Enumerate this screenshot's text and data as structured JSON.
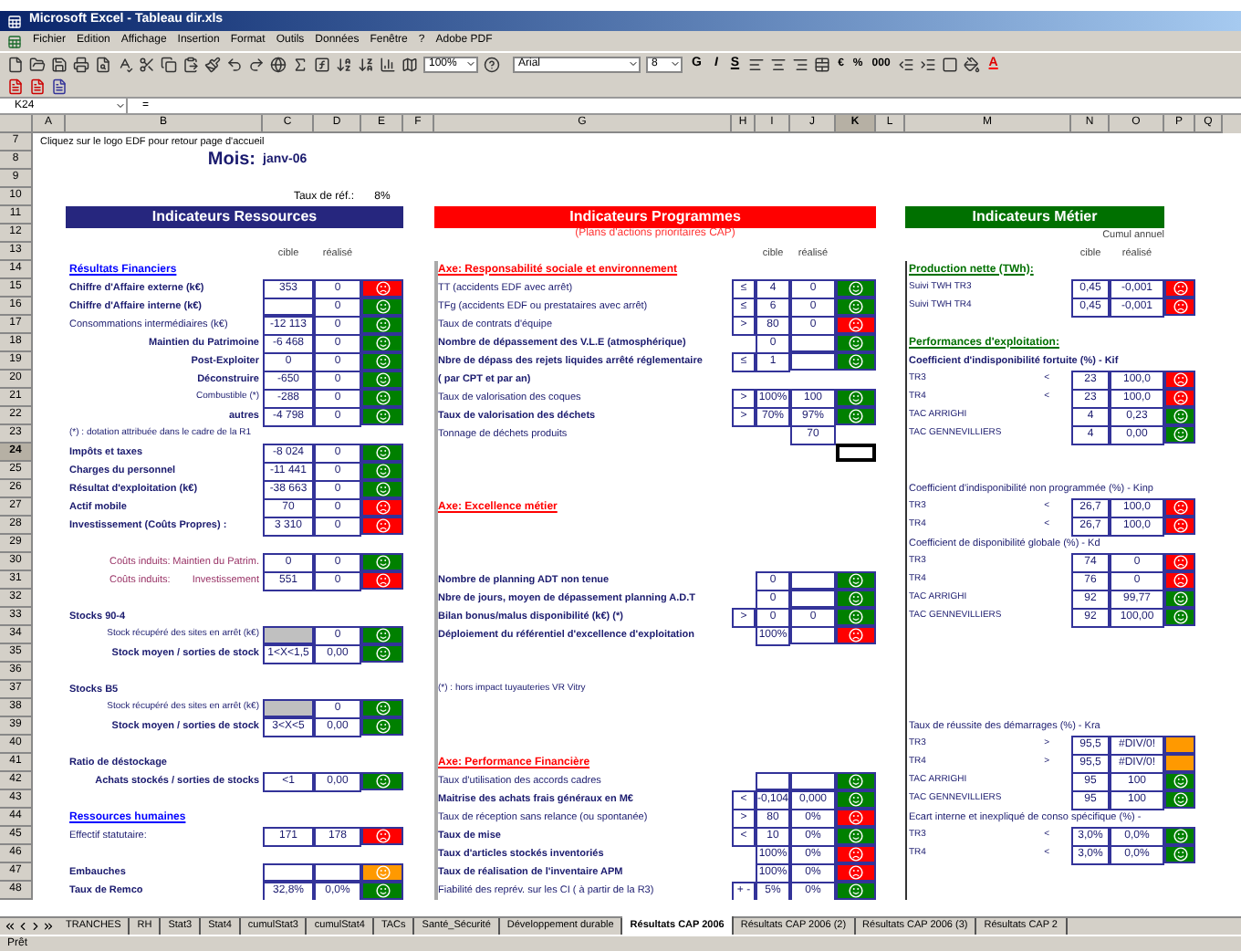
{
  "window": {
    "title": "Microsoft Excel - Tableau dir.xls"
  },
  "menu": [
    "Fichier",
    "Edition",
    "Affichage",
    "Insertion",
    "Format",
    "Outils",
    "Données",
    "Fenêtre",
    "?",
    "Adobe PDF"
  ],
  "toolbar": {
    "zoom": "100%",
    "font": "Arial",
    "size": "8",
    "style_buttons": [
      "G",
      "I",
      "S"
    ],
    "number_buttons": [
      "€",
      "%",
      "000"
    ],
    "font_color": "A"
  },
  "name_box": "K24",
  "formula_sign": "=",
  "columns": [
    "A",
    "B",
    "C",
    "D",
    "E",
    "F",
    "G",
    "H",
    "I",
    "J",
    "K",
    "L",
    "M",
    "N",
    "O",
    "P",
    "Q"
  ],
  "rows": [
    {
      "number": "7",
      "ressources": {
        "kind": "hint",
        "label": "Cliquez sur le logo EDF pour retour page d'accueil"
      }
    },
    {
      "number": "8",
      "ressources": {
        "kind": "month",
        "label": "Mois:",
        "value": "janv-06"
      }
    },
    {
      "number": "9"
    },
    {
      "number": "10",
      "ressources": {
        "kind": "rate",
        "label": "Taux de réf.:",
        "value": "8%"
      }
    },
    {
      "number": "11",
      "ressources": {
        "kind": "banner",
        "color": "#26267e",
        "label": "Indicateurs Ressources"
      },
      "programmes": {
        "kind": "banner",
        "color": "#ff0000",
        "label": "Indicateurs Programmes"
      },
      "metier": {
        "kind": "banner",
        "color": "#007000",
        "label": "Indicateurs Métier"
      }
    },
    {
      "number": "12",
      "programmes": {
        "kind": "subtitle",
        "label": "(Plans d'actions prioritaires CAP)"
      },
      "metier": {
        "kind": "cumul",
        "label": "Cumul annuel"
      }
    },
    {
      "number": "13",
      "ressources": {
        "kind": "colheads",
        "cible": "cible",
        "realise": "réalisé"
      },
      "programmes": {
        "kind": "colheads",
        "cible": "cible",
        "realise": "réalisé"
      },
      "metier": {
        "kind": "colheads",
        "cible": "cible",
        "realise": "réalisé"
      }
    },
    {
      "number": "14",
      "ressources": {
        "kind": "section",
        "color": "#0000ff",
        "label": "Résultats Financiers"
      },
      "programmes": {
        "kind": "section",
        "color": "#ff0000",
        "label": "Axe: Responsabilité sociale et environnement"
      },
      "metier": {
        "kind": "section",
        "color": "#007000",
        "label": "Production nette (TWh):"
      }
    },
    {
      "number": "15",
      "ressources": {
        "kind": "bold",
        "label": "Chiffre d'Affaire externe (k€)",
        "cible": "353",
        "realise": "0",
        "status": {
          "color": "#ff0000",
          "happy": false
        }
      },
      "programmes": {
        "kind": "plain",
        "label": "TT    (accidents EDF avec arrêt)",
        "op": "≤",
        "cible": "4",
        "realise": "0",
        "status": {
          "color": "#008000",
          "happy": true
        }
      },
      "metier": {
        "kind": "metric",
        "label": "Suivi TWH TR3",
        "cible": "0,45",
        "realise": "-0,001",
        "status": {
          "color": "#ff0000",
          "happy": false
        }
      }
    },
    {
      "number": "16",
      "ressources": {
        "kind": "bold",
        "label": "Chiffre d'Affaire interne (k€)",
        "realise": "0",
        "status": {
          "color": "#008000",
          "happy": true
        }
      },
      "programmes": {
        "kind": "plain",
        "label": "TFg   (accidents EDF ou prestataires avec arrêt)",
        "op": "≤",
        "cible": "6",
        "realise": "0",
        "status": {
          "color": "#008000",
          "happy": true
        }
      },
      "metier": {
        "kind": "metric",
        "label": "Suivi TWH TR4",
        "cible": "0,45",
        "realise": "-0,001",
        "status": {
          "color": "#ff0000",
          "happy": false
        }
      }
    },
    {
      "number": "17",
      "ressources": {
        "kind": "plain",
        "label": "Consommations intermédiaires (k€)",
        "cible": "-12 113",
        "realise": "0",
        "status": {
          "color": "#008000",
          "happy": true
        }
      },
      "programmes": {
        "kind": "plain",
        "label": "Taux de contrats d'équipe",
        "op": ">",
        "cible": "80",
        "realise": "0",
        "status": {
          "color": "#ff0000",
          "happy": false
        }
      }
    },
    {
      "number": "18",
      "ressources": {
        "kind": "bold_right",
        "label": "Maintien du Patrimoine",
        "cible": "-6 468",
        "realise": "0",
        "status": {
          "color": "#008000",
          "happy": true
        }
      },
      "programmes": {
        "kind": "bold",
        "label": "Nombre de dépassement des V.L.E (atmosphérique)",
        "cible": "0",
        "status": {
          "color": "#008000",
          "happy": true
        }
      },
      "metier": {
        "kind": "section",
        "color": "#007000",
        "label": "Performances d'exploitation:"
      }
    },
    {
      "number": "19",
      "ressources": {
        "kind": "bold_right",
        "label": "Post-Exploiter",
        "cible": "0",
        "realise": "0",
        "status": {
          "color": "#008000",
          "happy": true
        }
      },
      "programmes": {
        "kind": "bold",
        "label": "Nbre de dépass des rejets liquides arrêté réglementaire",
        "op": "≤",
        "cible": "1",
        "status": {
          "color": "#008000",
          "happy": true
        }
      },
      "metier": {
        "kind": "bold",
        "label": "Coefficient d'indisponibilité fortuite (%) - Kif"
      }
    },
    {
      "number": "20",
      "ressources": {
        "kind": "bold_right",
        "label": "Déconstruire",
        "cible": "-650",
        "realise": "0",
        "status": {
          "color": "#008000",
          "happy": true
        }
      },
      "programmes": {
        "kind": "bold",
        "label": "( par CPT et par an)"
      },
      "metier": {
        "kind": "metric",
        "label": "TR3",
        "op": "<",
        "cible": "23",
        "realise": "100,0",
        "status": {
          "color": "#ff0000",
          "happy": false
        }
      }
    },
    {
      "number": "21",
      "ressources": {
        "kind": "small_right",
        "label": "Combustible (*)",
        "cible": "-288",
        "realise": "0",
        "status": {
          "color": "#008000",
          "happy": true
        }
      },
      "programmes": {
        "kind": "plain",
        "label": "Taux de valorisation des coques",
        "op": ">",
        "cible": "100%",
        "realise": "100",
        "status": {
          "color": "#008000",
          "happy": true
        }
      },
      "metier": {
        "kind": "metric",
        "label": "TR4",
        "op": "<",
        "cible": "23",
        "realise": "100,0",
        "status": {
          "color": "#ff0000",
          "happy": false
        }
      }
    },
    {
      "number": "22",
      "ressources": {
        "kind": "bold_right",
        "label": "autres",
        "cible": "-4 798",
        "realise": "0",
        "status": {
          "color": "#008000",
          "happy": true
        }
      },
      "programmes": {
        "kind": "bold",
        "label": "Taux de valorisation des déchets",
        "op": ">",
        "cible": "70%",
        "realise": "97%",
        "status": {
          "color": "#008000",
          "happy": true
        }
      },
      "metier": {
        "kind": "metric",
        "label": "TAC ARRIGHI",
        "cible": "4",
        "realise": "0,23",
        "status": {
          "color": "#008000",
          "happy": true
        }
      }
    },
    {
      "number": "23",
      "ressources": {
        "kind": "note",
        "label": "(*) : dotation attribuée dans le cadre de la  R1"
      },
      "programmes": {
        "kind": "plain",
        "label": "Tonnage de déchets produits",
        "realise": "70"
      },
      "metier": {
        "kind": "metric",
        "label": "TAC GENNEVILLIERS",
        "cible": "4",
        "realise": "0,00",
        "status": {
          "color": "#008000",
          "happy": true
        }
      }
    },
    {
      "number": "24",
      "ressources": {
        "kind": "bold",
        "label": "Impôts et taxes",
        "cible": "-8 024",
        "realise": "0",
        "status": {
          "color": "#008000",
          "happy": true
        }
      },
      "programmes": {
        "kind": "cursor"
      }
    },
    {
      "number": "25",
      "ressources": {
        "kind": "bold",
        "label": "Charges du personnel",
        "cible": "-11 441",
        "realise": "0",
        "status": {
          "color": "#008000",
          "happy": true
        }
      }
    },
    {
      "number": "26",
      "ressources": {
        "kind": "bold",
        "label": "Résultat d'exploitation (k€)",
        "cible": "-38 663",
        "realise": "0",
        "status": {
          "color": "#008000",
          "happy": true
        }
      },
      "metier": {
        "kind": "plain",
        "label": "Coefficient d'indisponibilité non programmée (%) - Kinp"
      }
    },
    {
      "number": "27",
      "ressources": {
        "kind": "bold",
        "label": "Actif mobile",
        "cible": "70",
        "realise": "0",
        "status": {
          "color": "#ff0000",
          "happy": false
        }
      },
      "programmes": {
        "kind": "section",
        "color": "#ff0000",
        "label": "Axe: Excellence métier"
      },
      "metier": {
        "kind": "metric",
        "label": "TR3",
        "op": "<",
        "cible": "26,7",
        "realise": "100,0",
        "status": {
          "color": "#ff0000",
          "happy": false
        }
      }
    },
    {
      "number": "28",
      "ressources": {
        "kind": "bold",
        "label": "Investissement (Coûts Propres) :",
        "cible": "3 310",
        "realise": "0",
        "status": {
          "color": "#ff0000",
          "happy": false
        }
      },
      "metier": {
        "kind": "metric",
        "label": "TR4",
        "op": "<",
        "cible": "26,7",
        "realise": "100,0",
        "status": {
          "color": "#ff0000",
          "happy": false
        }
      }
    },
    {
      "number": "29",
      "metier": {
        "kind": "plain",
        "label": "Coefficient de disponibilité globale (%) - Kd"
      }
    },
    {
      "number": "30",
      "ressources": {
        "kind": "induced",
        "lead": "Coûts induits:",
        "label": "Maintien du Patrim.",
        "cible": "0",
        "realise": "0",
        "status": {
          "color": "#008000",
          "happy": true
        }
      },
      "metier": {
        "kind": "metric",
        "label": "TR3",
        "cible": "74",
        "realise": "0",
        "status": {
          "color": "#ff0000",
          "happy": false
        }
      }
    },
    {
      "number": "31",
      "ressources": {
        "kind": "induced",
        "lead": "Coûts induits:",
        "label": "Investissement",
        "cible": "551",
        "realise": "0",
        "status": {
          "color": "#ff0000",
          "happy": false
        }
      },
      "programmes": {
        "kind": "bold",
        "label": "Nombre de planning ADT non tenue",
        "cible": "0",
        "status": {
          "color": "#008000",
          "happy": true
        }
      },
      "metier": {
        "kind": "metric",
        "label": "TR4",
        "cible": "76",
        "realise": "0",
        "status": {
          "color": "#ff0000",
          "happy": false
        }
      }
    },
    {
      "number": "32",
      "programmes": {
        "kind": "bold",
        "label": "Nbre de jours, moyen de dépassement planning A.D.T",
        "cible": "0",
        "status": {
          "color": "#008000",
          "happy": true
        }
      },
      "metier": {
        "kind": "metric",
        "label": "TAC ARRIGHI",
        "cible": "92",
        "realise": "99,77",
        "status": {
          "color": "#008000",
          "happy": true
        }
      }
    },
    {
      "number": "33",
      "ressources": {
        "kind": "bold",
        "label": "Stocks 90-4"
      },
      "programmes": {
        "kind": "bold",
        "label": "Bilan bonus/malus disponibilité (k€)  (*)",
        "op": ">",
        "cible": "0",
        "realise": "0",
        "status": {
          "color": "#008000",
          "happy": true
        }
      },
      "metier": {
        "kind": "metric",
        "label": "TAC GENNEVILLIERS",
        "cible": "92",
        "realise": "100,00",
        "status": {
          "color": "#008000",
          "happy": true
        }
      }
    },
    {
      "number": "34",
      "ressources": {
        "kind": "greyed",
        "label": "Stock récupéré des sites en arrêt (k€)",
        "realise": "0",
        "status": {
          "color": "#008000",
          "happy": true
        }
      },
      "programmes": {
        "kind": "bold",
        "label": "Déploiement du référentiel d'excellence d'exploitation",
        "cible": "100%",
        "status": {
          "color": "#ff0000",
          "happy": false
        }
      }
    },
    {
      "number": "35",
      "ressources": {
        "kind": "bold_right",
        "label": "Stock moyen / sorties de stock",
        "cible": "1<X<1,5",
        "realise": "0,00",
        "status": {
          "color": "#008000",
          "happy": true
        }
      }
    },
    {
      "number": "36"
    },
    {
      "number": "37",
      "ressources": {
        "kind": "bold",
        "label": "Stocks B5"
      },
      "programmes": {
        "kind": "note",
        "label": "(*) : hors impact tuyauteries VR Vitry"
      }
    },
    {
      "number": "38",
      "ressources": {
        "kind": "greyed",
        "label": "Stock récupéré des sites en arrêt (k€)",
        "realise": "0",
        "status": {
          "color": "#008000",
          "happy": true
        }
      }
    },
    {
      "number": "39",
      "ressources": {
        "kind": "bold_right",
        "label": "Stock moyen / sorties de stock",
        "cible": "3<X<5",
        "realise": "0,00",
        "status": {
          "color": "#008000",
          "happy": true
        }
      },
      "metier": {
        "kind": "plain",
        "label": "Taux de réussite des démarrages (%) - Kra"
      }
    },
    {
      "number": "40",
      "metier": {
        "kind": "metric",
        "label": "TR3",
        "op": ">",
        "cible": "95,5",
        "realise": "#DIV/0!",
        "status": {
          "color": "#ff9900"
        }
      }
    },
    {
      "number": "41",
      "ressources": {
        "kind": "bold",
        "label": "Ratio de déstockage"
      },
      "programmes": {
        "kind": "section",
        "color": "#ff0000",
        "label": "Axe: Performance Financière"
      },
      "metier": {
        "kind": "metric",
        "label": "TR4",
        "op": ">",
        "cible": "95,5",
        "realise": "#DIV/0!",
        "status": {
          "color": "#ff9900"
        }
      }
    },
    {
      "number": "42",
      "ressources": {
        "kind": "bold_right",
        "label": "Achats stockés / sorties de stocks",
        "cible": "<1",
        "realise": "0,00",
        "status": {
          "color": "#008000",
          "happy": true
        }
      },
      "programmes": {
        "kind": "plain",
        "label": "Taux d'utilisation des accords cadres",
        "status": {
          "color": "#008000",
          "happy": true
        }
      },
      "metier": {
        "kind": "metric",
        "label": "TAC ARRIGHI",
        "cible": "95",
        "realise": "100",
        "status": {
          "color": "#008000",
          "happy": true
        }
      }
    },
    {
      "number": "43",
      "programmes": {
        "kind": "bold",
        "label": "Maitrise des achats frais généraux en M€",
        "op": "<",
        "cible": "-0,104",
        "realise": "0,000",
        "status": {
          "color": "#008000",
          "happy": true
        }
      },
      "metier": {
        "kind": "metric",
        "label": "TAC GENNEVILLIERS",
        "cible": "95",
        "realise": "100",
        "status": {
          "color": "#008000",
          "happy": true
        }
      }
    },
    {
      "number": "44",
      "ressources": {
        "kind": "section",
        "color": "#0000ff",
        "label": "Ressources humaines"
      },
      "programmes": {
        "kind": "plain",
        "label": "Taux de réception sans relance (ou spontanée)",
        "op": ">",
        "cible": "80",
        "realise": "0%",
        "status": {
          "color": "#ff0000",
          "happy": false
        }
      },
      "metier": {
        "kind": "plain",
        "label": "Ecart interne et inexpliqué de conso spécifique (%) -"
      }
    },
    {
      "number": "45",
      "ressources": {
        "kind": "plain",
        "label": "Effectif statutaire:",
        "cible": "171",
        "realise": "178",
        "status": {
          "color": "#ff0000",
          "happy": false
        }
      },
      "programmes": {
        "kind": "bold",
        "label": "Taux de mise",
        "op": "<",
        "cible": "10",
        "realise": "0%",
        "status": {
          "color": "#008000",
          "happy": true
        }
      },
      "metier": {
        "kind": "metric",
        "label": "TR3",
        "op": "<",
        "cible": "3,0%",
        "realise": "0,0%",
        "status": {
          "color": "#008000",
          "happy": true
        }
      }
    },
    {
      "number": "46",
      "programmes": {
        "kind": "bold",
        "label": "Taux d'articles stockés inventoriés",
        "cible": "100%",
        "realise": "0%",
        "status": {
          "color": "#ff0000",
          "happy": false
        }
      },
      "metier": {
        "kind": "metric",
        "label": "TR4",
        "op": "<",
        "cible": "3,0%",
        "realise": "0,0%",
        "status": {
          "color": "#008000",
          "happy": true
        }
      }
    },
    {
      "number": "47",
      "ressources": {
        "kind": "bold",
        "label": "Embauches",
        "status": {
          "color": "#ff9900",
          "happy": true
        }
      },
      "programmes": {
        "kind": "bold",
        "label": "Taux de réalisation de l'inventaire APM",
        "cible": "100%",
        "realise": "0%",
        "status": {
          "color": "#ff0000",
          "happy": false
        }
      }
    },
    {
      "number": "48",
      "ressources": {
        "kind": "bold",
        "label": "Taux de Remco",
        "cible": "32,8%",
        "realise": "0,0%",
        "status": {
          "color": "#008000",
          "happy": true
        }
      },
      "programmes": {
        "kind": "plain",
        "label": "Fiabilité des reprév. sur les CI ( à partir de la R3)",
        "op": "+ -",
        "cible": "5%",
        "realise": "0%",
        "status": {
          "color": "#008000",
          "happy": true
        }
      }
    }
  ],
  "tabs": [
    {
      "label": "TRANCHES",
      "selected": false
    },
    {
      "label": "RH",
      "selected": false
    },
    {
      "label": "Stat3",
      "selected": false
    },
    {
      "label": "Stat4",
      "selected": false
    },
    {
      "label": "cumulStat3",
      "selected": false
    },
    {
      "label": "cumulStat4",
      "selected": false
    },
    {
      "label": "TACs",
      "selected": false
    },
    {
      "label": "Santé_Sécurité",
      "selected": false
    },
    {
      "label": "Développement durable",
      "selected": false
    },
    {
      "label": "Résultats CAP 2006",
      "selected": true
    },
    {
      "label": "Résultats CAP 2006 (2)",
      "selected": false
    },
    {
      "label": "Résultats CAP 2006 (3)",
      "selected": false
    },
    {
      "label": "Résultats CAP 2",
      "selected": false
    }
  ],
  "status_bar": "Prêt"
}
